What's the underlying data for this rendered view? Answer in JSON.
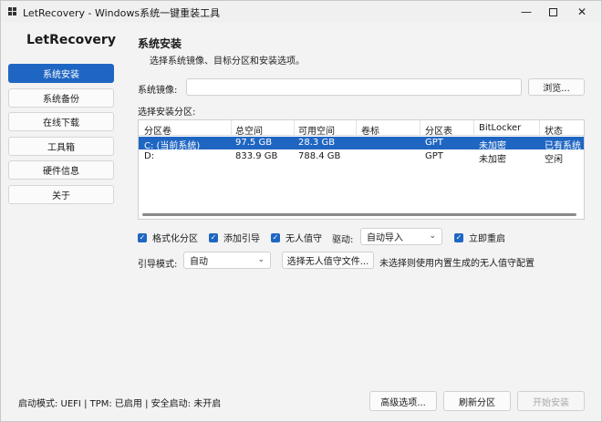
{
  "window": {
    "title": "LetRecovery - Windows系统一键重装工具",
    "controls": {
      "minimize": "—",
      "close": "✕"
    }
  },
  "sidebar": {
    "brand": "LetRecovery",
    "items": [
      {
        "label": "系统安装",
        "active": true
      },
      {
        "label": "系统备份",
        "active": false
      },
      {
        "label": "在线下载",
        "active": false
      },
      {
        "label": "工具箱",
        "active": false
      },
      {
        "label": "硬件信息",
        "active": false
      },
      {
        "label": "关于",
        "active": false
      }
    ]
  },
  "main": {
    "title": "系统安装",
    "subtitle": "选择系统镜像、目标分区和安装选项。",
    "image_label": "系统镜像:",
    "image_value": "",
    "browse_label": "浏览...",
    "partition_label": "选择安装分区:",
    "table": {
      "columns": [
        "分区卷",
        "总空间",
        "可用空间",
        "卷标",
        "分区表",
        "BitLocker",
        "状态"
      ],
      "rows": [
        [
          "C: (当前系统)",
          "97.5 GB",
          "28.3 GB",
          "",
          "GPT",
          "未加密",
          "已有系统"
        ],
        [
          "D:",
          "833.9 GB",
          "788.4 GB",
          "",
          "GPT",
          "未加密",
          "空闲"
        ]
      ],
      "selected_row": 0
    },
    "options": {
      "format": {
        "label": "格式化分区",
        "checked": true
      },
      "add_boot": {
        "label": "添加引导",
        "checked": true
      },
      "unattended": {
        "label": "无人值守",
        "checked": true
      },
      "driver_label": "驱动:",
      "driver_value": "自动导入",
      "restart": {
        "label": "立即重启",
        "checked": true
      },
      "boot_mode_label": "引导模式:",
      "boot_mode_value": "自动",
      "unattend_file_button": "选择无人值守文件...",
      "unattend_note": "未选择则使用内置生成的无人值守配置"
    }
  },
  "footer": {
    "status": "启动模式: UEFI | TPM: 已启用 | 安全启动: 未开启",
    "advanced_button": "高级选项...",
    "refresh_button": "刷新分区",
    "start_button": "开始安装"
  },
  "icons": {
    "check": "✓",
    "chevron": "⌄"
  }
}
